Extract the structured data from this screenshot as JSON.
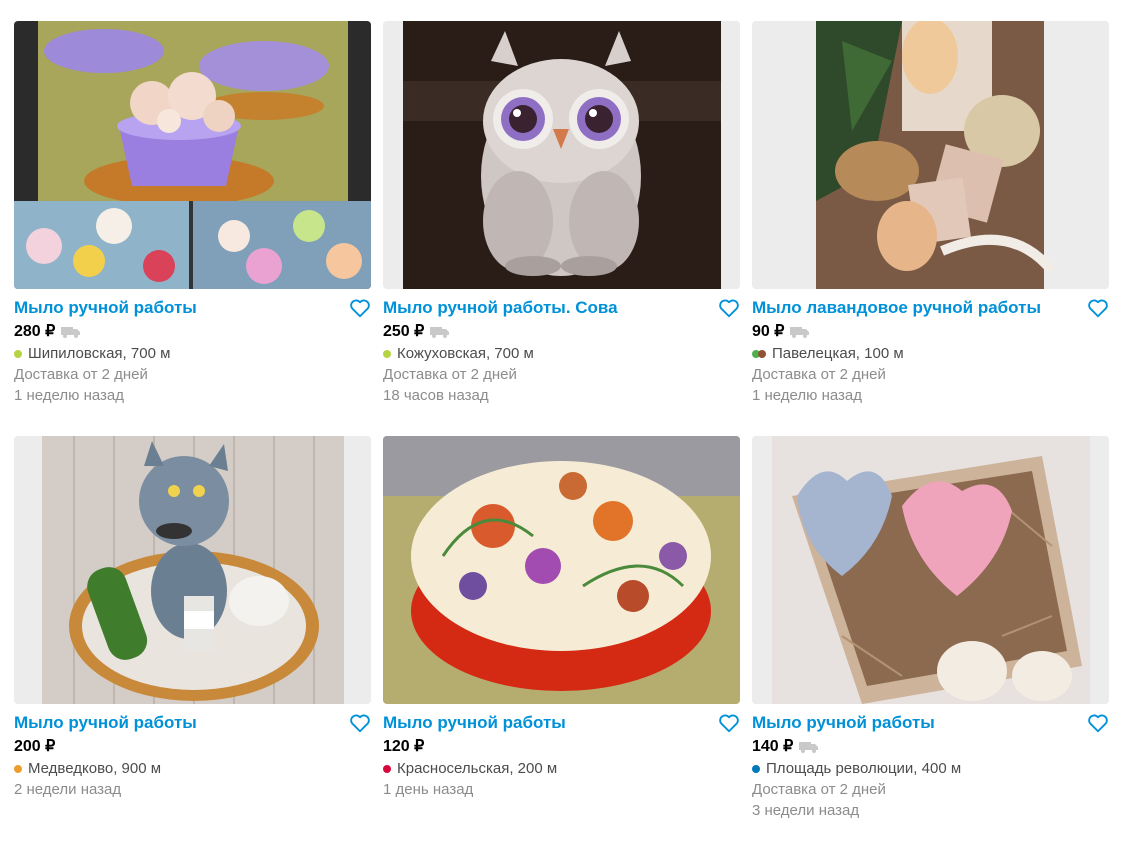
{
  "currency": "₽",
  "listings": [
    {
      "title": "Мыло ручной работы",
      "price": "280 ₽",
      "has_delivery": true,
      "metro": "Шипиловская, 700 м",
      "metro_colors": [
        "#b4d445"
      ],
      "delivery": "Доставка от 2 дней",
      "posted": "1 неделю назад",
      "image": "cups-soap"
    },
    {
      "title": "Мыло ручной работы. Сова",
      "price": "250 ₽",
      "has_delivery": true,
      "metro": "Кожуховская, 700 м",
      "metro_colors": [
        "#b4d445"
      ],
      "delivery": "Доставка от 2 дней",
      "posted": "18 часов назад",
      "image": "owl-soap"
    },
    {
      "title": "Мыло лавандовое ручной работы",
      "price": "90 ₽",
      "has_delivery": true,
      "metro": "Павелецкая, 100 м",
      "metro_colors": [
        "#4fb04f",
        "#915133"
      ],
      "delivery": "Доставка от 2 дней",
      "posted": "1 неделю назад",
      "image": "lavender-soap"
    },
    {
      "title": "Мыло ручной работы",
      "price": "200 ₽",
      "has_delivery": false,
      "metro": "Медведково, 900 м",
      "metro_colors": [
        "#ed9f2d"
      ],
      "delivery": "",
      "posted": "2 недели назад",
      "image": "wolf-soap"
    },
    {
      "title": "Мыло ручной работы",
      "price": "120 ₽",
      "has_delivery": false,
      "metro": "Красносельская, 200 м",
      "metro_colors": [
        "#d6083b"
      ],
      "delivery": "",
      "posted": "1 день назад",
      "image": "round-floral-soap"
    },
    {
      "title": "Мыло ручной работы",
      "price": "140 ₽",
      "has_delivery": true,
      "metro": "Площадь революции, 400 м",
      "metro_colors": [
        "#0078be"
      ],
      "delivery": "Доставка от 2 дней",
      "posted": "3 недели назад",
      "image": "heart-soap"
    }
  ],
  "colors": {
    "title": "#0091d9",
    "price": "#000000",
    "meta": "#8c8c8c",
    "favorite": "#0091d9"
  }
}
